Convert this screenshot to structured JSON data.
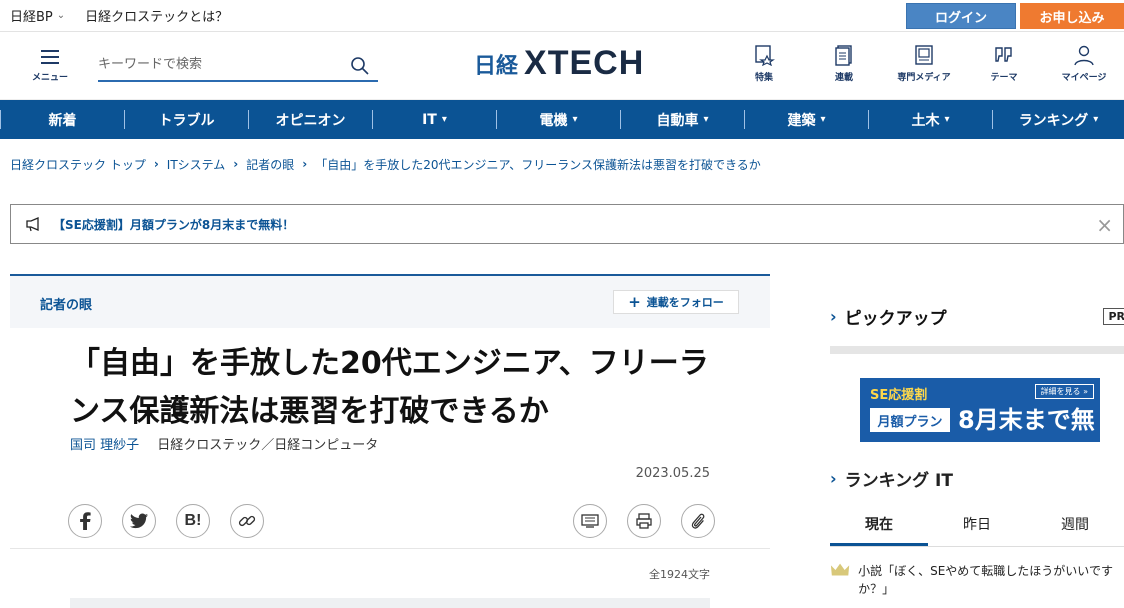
{
  "topbar": {
    "nikkei_bp": "日経BP",
    "what": "日経クロステックとは？",
    "login": "ログイン",
    "apply": "お申し込み"
  },
  "header": {
    "menu_label": "メニュー",
    "search_placeholder": "キーワードで検索",
    "logo_jp": "日経",
    "logo_en": "XTECH",
    "nav": [
      {
        "label": "特集",
        "icon": "feature-icon"
      },
      {
        "label": "連載",
        "icon": "series-icon"
      },
      {
        "label": "専門メディア",
        "icon": "media-icon"
      },
      {
        "label": "テーマ",
        "icon": "theme-icon"
      },
      {
        "label": "マイページ",
        "icon": "user-icon"
      }
    ]
  },
  "global_nav": [
    {
      "label": "新着",
      "dropdown": false
    },
    {
      "label": "トラブル",
      "dropdown": false
    },
    {
      "label": "オピニオン",
      "dropdown": false
    },
    {
      "label": "IT",
      "dropdown": true
    },
    {
      "label": "電機",
      "dropdown": true
    },
    {
      "label": "自動車",
      "dropdown": true
    },
    {
      "label": "建築",
      "dropdown": true
    },
    {
      "label": "土木",
      "dropdown": true
    },
    {
      "label": "ランキング",
      "dropdown": true
    }
  ],
  "breadcrumb": [
    "日経クロステック トップ",
    "ITシステム",
    "記者の眼",
    "「自由」を手放した20代エンジニア、フリーランス保護新法は悪習を打破できるか"
  ],
  "notice": {
    "text": "【SE応援割】月額プランが8月末まで無料！"
  },
  "article": {
    "series": "記者の眼",
    "follow": "連載をフォロー",
    "title": "「自由」を手放した20代エンジニア、フリーランス保護新法は悪習を打破できるか",
    "author": "国司 理紗子",
    "publication": "日経クロステック／日経コンピュータ",
    "date": "2023.05.25",
    "char_count": "全1924文字"
  },
  "sidebar": {
    "pickup": "ピックアップ",
    "pr": "PR",
    "banner": {
      "line1": "SE応援割",
      "plan": "月額プラン",
      "free": "8月末まで無料!",
      "detail": "詳細を見る »"
    },
    "ranking_title": "ランキング IT",
    "tabs": [
      "現在",
      "昨日",
      "週間"
    ],
    "first_item": "小説「ぼく、SEやめて転職したほうがいいですか？」"
  },
  "colors": {
    "brand_blue": "#0b5394",
    "login_blue": "#4a85c4",
    "apply_orange": "#ef7a30"
  }
}
